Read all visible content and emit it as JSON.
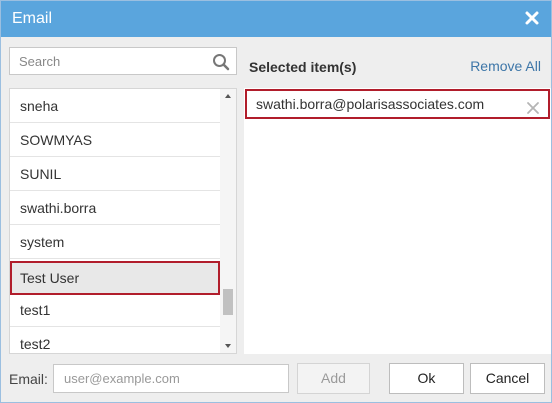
{
  "dialog": {
    "title": "Email",
    "close_icon": "close-icon"
  },
  "search": {
    "placeholder": "Search",
    "icon": "search-icon"
  },
  "user_list": {
    "items": [
      {
        "label": "sneha"
      },
      {
        "label": "SOWMYAS"
      },
      {
        "label": "SUNIL"
      },
      {
        "label": "swathi.borra"
      },
      {
        "label": "system"
      },
      {
        "label": "Test User",
        "selected": true
      },
      {
        "label": "test1"
      },
      {
        "label": "test2"
      }
    ]
  },
  "selected_panel": {
    "header": "Selected item(s)",
    "remove_all": "Remove All",
    "items": [
      {
        "label": "swathi.borra@polarisassociates.com"
      }
    ]
  },
  "footer": {
    "email_label": "Email:",
    "email_placeholder": "user@example.com",
    "add_label": "Add",
    "ok_label": "Ok",
    "cancel_label": "Cancel"
  },
  "colors": {
    "titlebar": "#5aa5dd",
    "highlight_border": "#b11d2b",
    "link": "#3d76a8"
  }
}
